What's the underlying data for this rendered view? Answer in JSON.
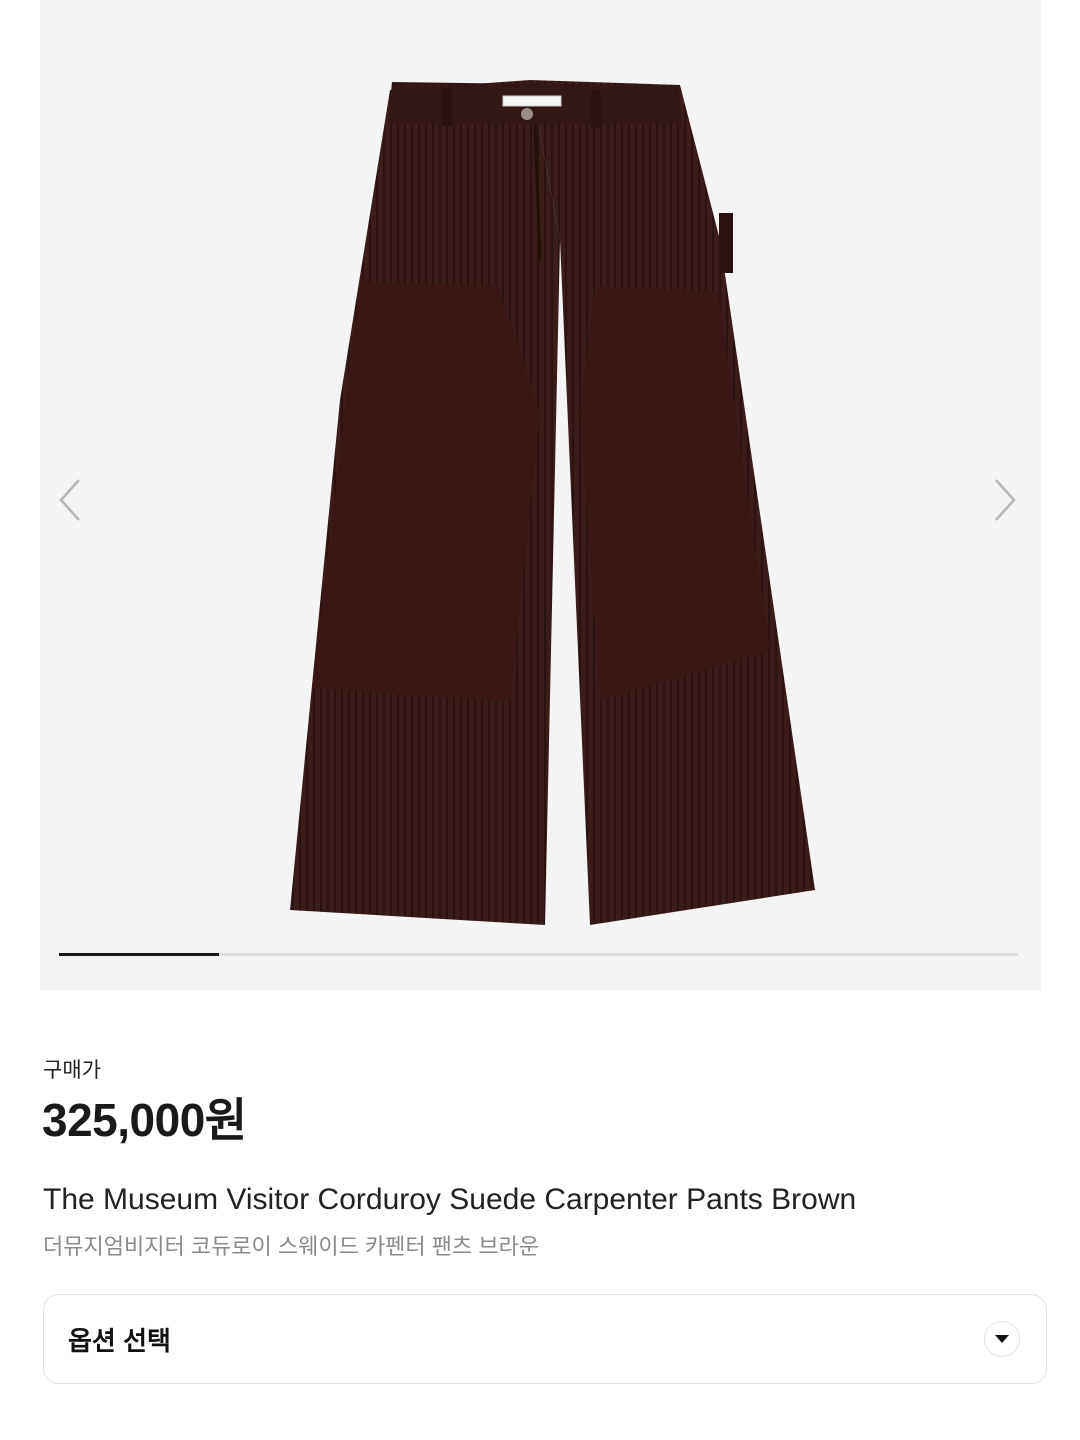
{
  "gallery": {
    "current_index": 1,
    "progress_fraction": 0.167,
    "image_alt": "The Museum Visitor Corduroy Suede Carpenter Pants Brown",
    "product_color": "#3a1a17",
    "background_color": "#f4f4f4",
    "prev_icon": "chevron-left-icon",
    "next_icon": "chevron-right-icon"
  },
  "product": {
    "price_label": "구매가",
    "price": "325,000원",
    "title_en": "The Museum Visitor Corduroy Suede Carpenter Pants Brown",
    "title_ko": "더뮤지엄비지터 코듀로이 스웨이드 카펜터 팬츠 브라운"
  },
  "option": {
    "label": "옵션 선택",
    "icon": "caret-down-icon"
  },
  "colors": {
    "progress_active": "#1a1a1a",
    "progress_track": "#dcdcdc",
    "subtitle": "#8a8a8a"
  }
}
